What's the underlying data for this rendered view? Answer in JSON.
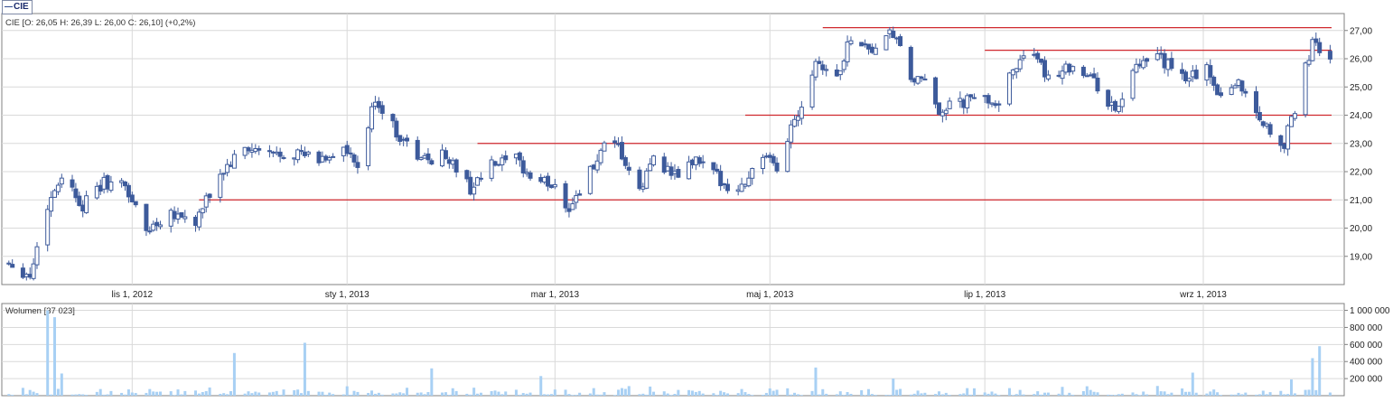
{
  "legend_tag": "CIE",
  "colors": {
    "candle_up": "#ffffff",
    "candle_down": "#3d5a9b",
    "candle_stroke": "#3d5a9b",
    "sr_line": "#d0282e",
    "volume": "#a8d0f4",
    "grid": "#d9d9d9",
    "axis": "#808080"
  },
  "chart_data": [
    {
      "type": "candlestick",
      "header": "CIE [O: 26,05  H: 26,39  L: 26,00  C: 26,10] (+0,2%)",
      "x_tick_labels": [
        "lis 1, 2012",
        "sty 1, 2013",
        "mar 1, 2013",
        "maj 1, 2013",
        "lip 1, 2013",
        "wrz 1, 2013"
      ],
      "x_ticks": [
        "2012-11-01",
        "2013-01-01",
        "2013-03-01",
        "2013-05-01",
        "2013-07-01",
        "2013-09-01"
      ],
      "x_range": [
        "2012-09-25",
        "2013-10-11"
      ],
      "y_tick_labels": [
        "19,00",
        "20,00",
        "21,00",
        "22,00",
        "23,00",
        "24,00",
        "25,00",
        "26,00",
        "27,00"
      ],
      "ylim": [
        18.0,
        27.6
      ],
      "grid": true,
      "horizontal_lines": [
        {
          "value": 21.0,
          "from": "2012-11-20"
        },
        {
          "value": 23.0,
          "from": "2013-02-07"
        },
        {
          "value": 24.0,
          "from": "2013-04-24"
        },
        {
          "value": 26.3,
          "from": "2013-07-01"
        },
        {
          "value": 27.1,
          "from": "2013-05-16"
        }
      ],
      "anchors": [
        [
          "2012-09-27",
          18.8
        ],
        [
          "2012-10-03",
          18.3
        ],
        [
          "2012-10-08",
          20.8
        ],
        [
          "2012-10-12",
          21.9
        ],
        [
          "2012-10-18",
          20.8
        ],
        [
          "2012-10-24",
          21.6
        ],
        [
          "2012-10-30",
          21.5
        ],
        [
          "2012-11-05",
          19.9
        ],
        [
          "2012-11-12",
          20.6
        ],
        [
          "2012-11-19",
          20.2
        ],
        [
          "2012-11-26",
          21.9
        ],
        [
          "2012-12-03",
          22.8
        ],
        [
          "2012-12-10",
          22.6
        ],
        [
          "2012-12-17",
          22.7
        ],
        [
          "2012-12-24",
          22.4
        ],
        [
          "2012-12-31",
          22.8
        ],
        [
          "2013-01-04",
          22.1
        ],
        [
          "2013-01-09",
          24.6
        ],
        [
          "2013-01-15",
          23.4
        ],
        [
          "2013-01-22",
          22.4
        ],
        [
          "2013-01-29",
          22.6
        ],
        [
          "2013-02-05",
          21.4
        ],
        [
          "2013-02-11",
          22.2
        ],
        [
          "2013-02-18",
          22.4
        ],
        [
          "2013-02-22",
          21.8
        ],
        [
          "2013-03-01",
          21.5
        ],
        [
          "2013-03-05",
          20.7
        ],
        [
          "2013-03-11",
          22.0
        ],
        [
          "2013-03-15",
          22.8
        ],
        [
          "2013-03-19",
          22.8
        ],
        [
          "2013-03-25",
          21.2
        ],
        [
          "2013-03-29",
          22.6
        ],
        [
          "2013-04-04",
          21.8
        ],
        [
          "2013-04-10",
          22.4
        ],
        [
          "2013-04-16",
          21.8
        ],
        [
          "2013-04-22",
          21.3
        ],
        [
          "2013-04-29",
          22.6
        ],
        [
          "2013-05-03",
          22.0
        ],
        [
          "2013-05-07",
          23.6
        ],
        [
          "2013-05-10",
          24.4
        ],
        [
          "2013-05-14",
          26.0
        ],
        [
          "2013-05-20",
          25.3
        ],
        [
          "2013-05-24",
          26.8
        ],
        [
          "2013-05-30",
          26.3
        ],
        [
          "2013-06-05",
          26.9
        ],
        [
          "2013-06-10",
          25.3
        ],
        [
          "2013-06-14",
          25.1
        ],
        [
          "2013-06-18",
          24.2
        ],
        [
          "2013-06-24",
          24.4
        ],
        [
          "2013-06-28",
          24.6
        ],
        [
          "2013-07-05",
          24.5
        ],
        [
          "2013-07-12",
          26.3
        ],
        [
          "2013-07-19",
          25.4
        ],
        [
          "2013-07-26",
          25.8
        ],
        [
          "2013-08-01",
          25.2
        ],
        [
          "2013-08-07",
          24.1
        ],
        [
          "2013-08-12",
          25.5
        ],
        [
          "2013-08-19",
          26.1
        ],
        [
          "2013-08-26",
          25.3
        ],
        [
          "2013-09-02",
          25.6
        ],
        [
          "2013-09-06",
          24.7
        ],
        [
          "2013-09-11",
          25.2
        ],
        [
          "2013-09-16",
          24.1
        ],
        [
          "2013-09-20",
          23.4
        ],
        [
          "2013-09-24",
          23.0
        ],
        [
          "2013-09-27",
          24.2
        ],
        [
          "2013-10-02",
          26.6
        ],
        [
          "2013-10-04",
          26.2
        ],
        [
          "2013-10-07",
          26.1
        ]
      ]
    },
    {
      "type": "bar",
      "header": "Wolumen [37 023]",
      "y_tick_labels": [
        "200 000",
        "400 000",
        "600 000",
        "800 000",
        "1 000 000"
      ],
      "ylim": [
        0,
        1080000
      ],
      "spikes": [
        [
          "2012-10-08",
          1000000
        ],
        [
          "2012-10-10",
          920000
        ],
        [
          "2012-10-12",
          260000
        ],
        [
          "2012-11-30",
          500000
        ],
        [
          "2012-12-20",
          620000
        ],
        [
          "2013-01-25",
          320000
        ],
        [
          "2013-02-25",
          230000
        ],
        [
          "2013-05-12",
          240000
        ],
        [
          "2013-05-14",
          330000
        ],
        [
          "2013-06-01",
          260000
        ],
        [
          "2013-06-05",
          200000
        ],
        [
          "2013-08-29",
          270000
        ],
        [
          "2013-09-26",
          190000
        ],
        [
          "2013-10-02",
          440000
        ],
        [
          "2013-10-04",
          580000
        ]
      ]
    }
  ]
}
